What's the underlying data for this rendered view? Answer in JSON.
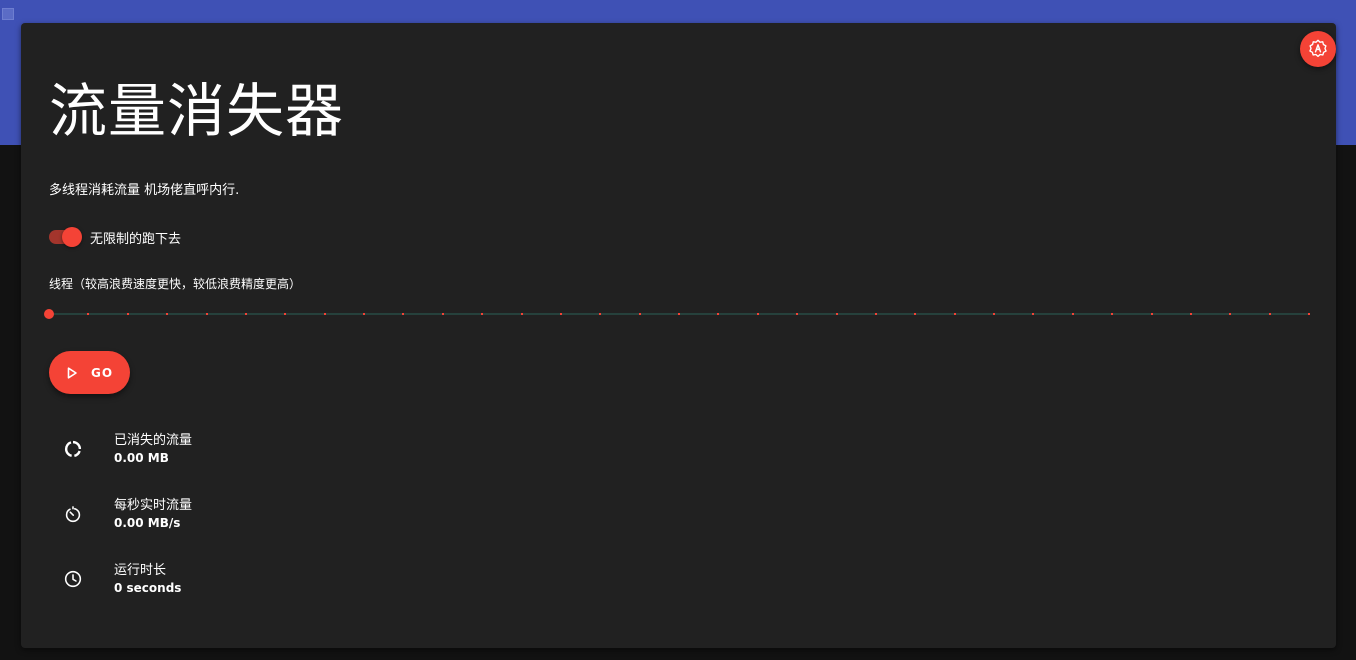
{
  "app": {
    "title": "流量消失器",
    "subtitle": "多线程消耗流量 机场佬直呼内行."
  },
  "colors": {
    "header": "#3f51b5",
    "card": "#212121",
    "accent": "#f44336",
    "background": "#121212"
  },
  "fab": {
    "icon": "translate-a-icon"
  },
  "unlimited_switch": {
    "label": "无限制的跑下去",
    "checked": true
  },
  "thread_slider": {
    "label": "线程（较高浪费速度更快，较低浪费精度更高）",
    "value_fraction": 0,
    "tick_count": 32
  },
  "go_button": {
    "label": "GO",
    "icon": "play-icon"
  },
  "stats": [
    {
      "label": "已消失的流量",
      "value": "0.00 MB",
      "icon": "progress-ring-icon"
    },
    {
      "label": "每秒实时流量",
      "value": "0.00 MB/s",
      "icon": "timer-icon"
    },
    {
      "label": "运行时长",
      "value": "0 seconds",
      "icon": "clock-icon"
    }
  ]
}
